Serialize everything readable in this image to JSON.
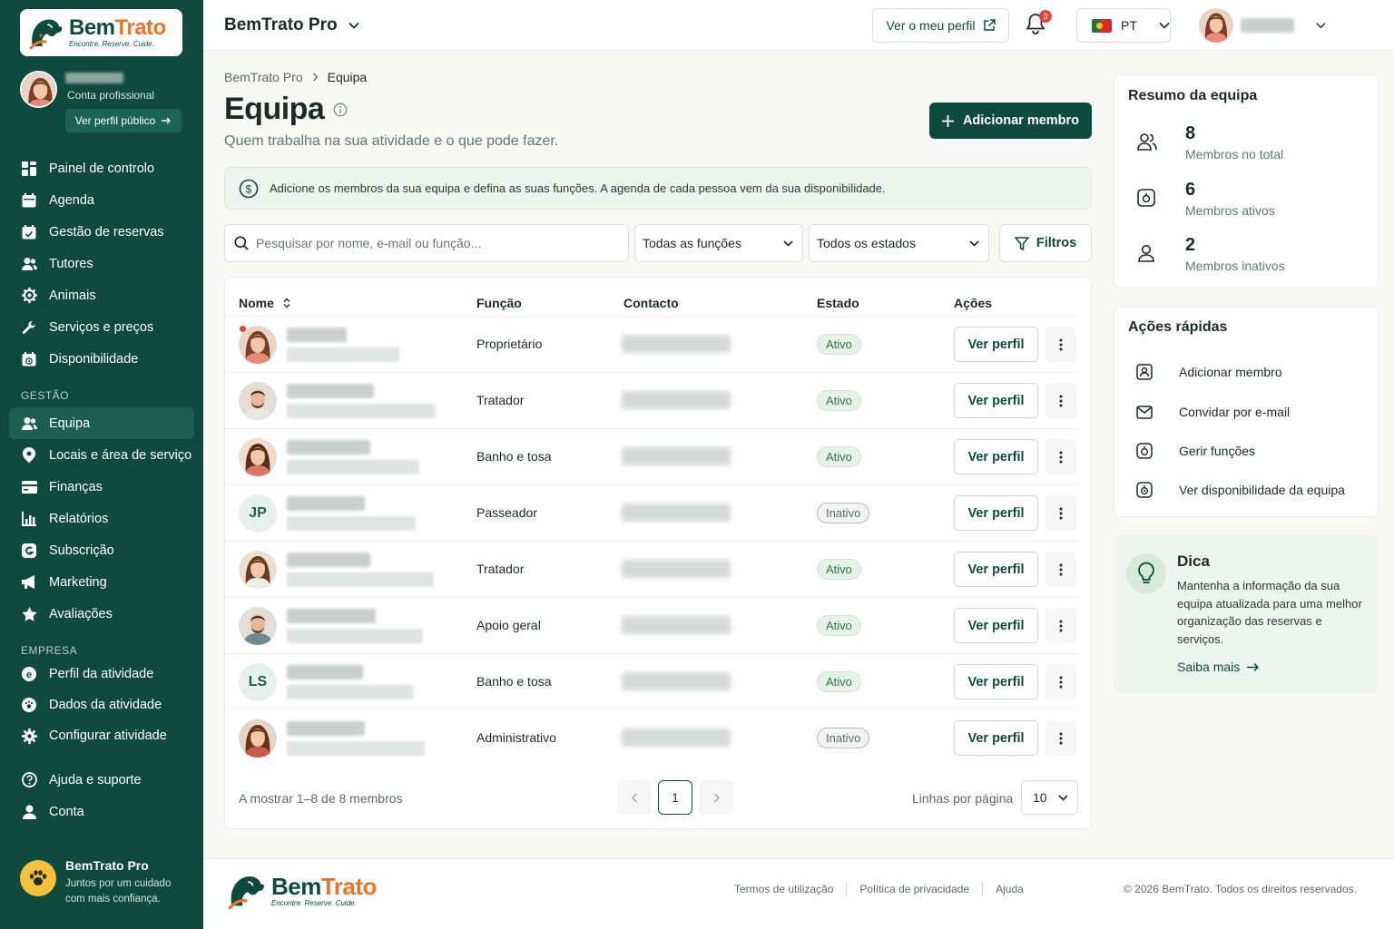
{
  "brand": {
    "name_part1": "Bem",
    "name_part2": "Trato",
    "tagline": "Encontre. Reserve. Cuide.",
    "primary_color": "#0e4a3e",
    "accent_color": "#e8742a"
  },
  "sidebar": {
    "profile": {
      "account_type": "Conta profissional",
      "public_profile_button": "Ver perfil público"
    },
    "main_items": [
      {
        "label": "Painel de controlo",
        "icon": "dashboard-icon"
      },
      {
        "label": "Agenda",
        "icon": "calendar-icon"
      },
      {
        "label": "Gestão de reservas",
        "icon": "calendar-check-icon"
      },
      {
        "label": "Tutores",
        "icon": "users-icon"
      },
      {
        "label": "Animais",
        "icon": "paw-icon"
      },
      {
        "label": "Serviços e preços",
        "icon": "wrench-icon"
      },
      {
        "label": "Disponibilidade",
        "icon": "calendar-clock-icon"
      }
    ],
    "section_gestao": "GESTÃO",
    "gestao_items": [
      {
        "label": "Equipa",
        "icon": "team-icon",
        "active": true
      },
      {
        "label": "Locais e área de serviço",
        "icon": "location-icon"
      },
      {
        "label": "Finanças",
        "icon": "wallet-icon"
      },
      {
        "label": "Relatórios",
        "icon": "bar-chart-icon"
      },
      {
        "label": "Subscrição",
        "icon": "subscription-icon"
      },
      {
        "label": "Marketing",
        "icon": "megaphone-icon"
      },
      {
        "label": "Avaliações",
        "icon": "star-icon"
      }
    ],
    "section_empresa": "EMPRESA",
    "empresa_items": [
      {
        "label": "Perfil da atividade",
        "icon": "paw-circle-icon"
      },
      {
        "label": "Dados da atividade",
        "icon": "paw-circle-icon"
      },
      {
        "label": "Configurar atividade",
        "icon": "gear-icon"
      }
    ],
    "support_items": [
      {
        "label": "Ajuda e suporte",
        "icon": "help-icon"
      },
      {
        "label": "Conta",
        "icon": "user-icon"
      }
    ],
    "bottom": {
      "title": "BemTrato Pro",
      "subtitle": "Juntos por um cuidado com mais confiança."
    }
  },
  "header": {
    "app_title": "BemTrato Pro",
    "view_profile_button": "Ver o meu perfil",
    "notification_count": "3",
    "language": "PT"
  },
  "breadcrumb": {
    "root": "BemTrato Pro",
    "current": "Equipa"
  },
  "page": {
    "title": "Equipa",
    "subtitle": "Quem trabalha na sua atividade e o que pode fazer.",
    "add_button": "Adicionar membro",
    "info_message": "Adicione os membros da sua equipa e defina as suas funções. A agenda de cada pessoa vem da sua disponibilidade."
  },
  "filters": {
    "search_placeholder": "Pesquisar por nome, e-mail ou função...",
    "role_select": "Todas as funções",
    "status_select": "Todos os estados",
    "filters_button": "Filtros"
  },
  "table": {
    "headers": {
      "name": "Nome",
      "role": "Função",
      "contact": "Contacto",
      "status": "Estado",
      "actions": "Ações"
    },
    "view_button": "Ver perfil",
    "rows": [
      {
        "avatar": "photo-f1",
        "role": "Proprietário",
        "status": "Ativo",
        "name_w": 66,
        "sub_w": 124
      },
      {
        "avatar": "photo-m1",
        "role": "Tratador",
        "status": "Ativo",
        "name_w": 96,
        "sub_w": 164
      },
      {
        "avatar": "photo-f2",
        "role": "Banho e tosa",
        "status": "Ativo",
        "name_w": 92,
        "sub_w": 146
      },
      {
        "avatar": "initials",
        "initials": "JP",
        "role": "Passeador",
        "status": "Inativo",
        "name_w": 86,
        "sub_w": 142
      },
      {
        "avatar": "photo-f3",
        "role": "Tratador",
        "status": "Ativo",
        "name_w": 92,
        "sub_w": 162
      },
      {
        "avatar": "photo-m2",
        "role": "Apoio geral",
        "status": "Ativo",
        "name_w": 98,
        "sub_w": 150
      },
      {
        "avatar": "initials",
        "initials": "LS",
        "role": "Banho e tosa",
        "status": "Ativo",
        "name_w": 84,
        "sub_w": 140
      },
      {
        "avatar": "photo-f4",
        "role": "Administrativo",
        "status": "Inativo",
        "name_w": 86,
        "sub_w": 152
      }
    ],
    "footer_count": "A mostrar 1–8 de 8 membros",
    "current_page": "1",
    "rows_per_page_label": "Linhas por página",
    "rows_per_page": "10"
  },
  "summary": {
    "title": "Resumo da equipa",
    "stats": [
      {
        "value": "8",
        "label": "Membros no total",
        "icon": "users-icon"
      },
      {
        "value": "6",
        "label": "Membros ativos",
        "icon": "active-icon"
      },
      {
        "value": "2",
        "label": "Membros inativos",
        "icon": "user-icon"
      }
    ]
  },
  "quick_actions": {
    "title": "Ações rápidas",
    "items": [
      {
        "label": "Adicionar membro",
        "icon": "add-user-icon"
      },
      {
        "label": "Convidar por e-mail",
        "icon": "mail-icon"
      },
      {
        "label": "Gerir funções",
        "icon": "roles-icon"
      },
      {
        "label": "Ver disponibilidade da equipa",
        "icon": "clock-icon"
      }
    ]
  },
  "tip": {
    "title": "Dica",
    "text": "Mantenha a informação da sua equipa atualizada para uma melhor organização das reservas e serviços.",
    "link": "Saiba mais"
  },
  "footer": {
    "links": [
      "Termos de utilização",
      "Política de privacidade",
      "Ajuda"
    ],
    "copyright": "© 2026 BemTrato. Todos os direitos reservados."
  }
}
